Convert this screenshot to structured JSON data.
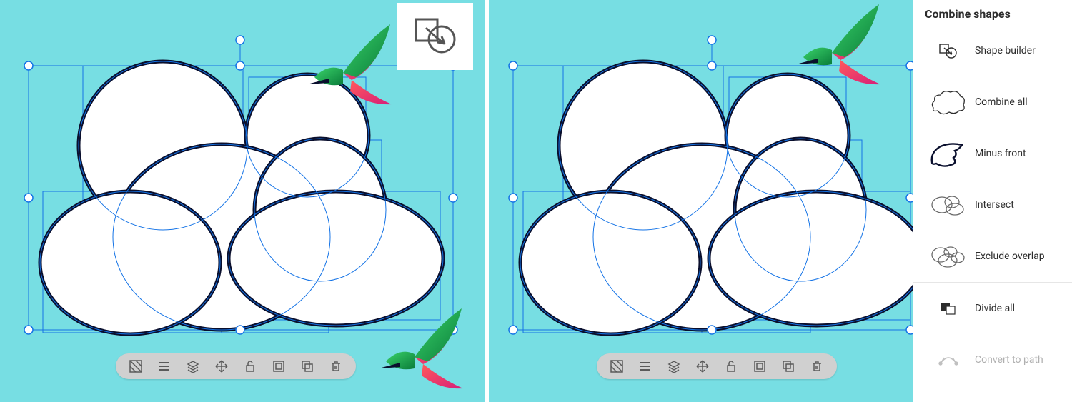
{
  "panel": {
    "title": "Combine shapes",
    "items": [
      {
        "id": "shape-builder",
        "label": "Shape builder",
        "icon": "shapebuilder",
        "interactable": true
      },
      {
        "id": "combine-all",
        "label": "Combine all",
        "icon": "combineall",
        "interactable": true
      },
      {
        "id": "minus-front",
        "label": "Minus front",
        "icon": "minusfront",
        "interactable": true
      },
      {
        "id": "intersect",
        "label": "Intersect",
        "icon": "intersect",
        "interactable": true
      },
      {
        "id": "exclude-overlap",
        "label": "Exclude overlap",
        "icon": "excludeoverlap",
        "interactable": true
      },
      {
        "id": "divide-all",
        "label": "Divide all",
        "icon": "divideall",
        "interactable": true,
        "divider": true
      },
      {
        "id": "convert-to-path",
        "label": "Convert to path",
        "icon": "converttopath",
        "interactable": false,
        "disabled": true
      }
    ]
  },
  "toolbar": {
    "items": [
      {
        "id": "opacity",
        "name": "opacity-icon"
      },
      {
        "id": "stroke",
        "name": "stroke-weight-icon"
      },
      {
        "id": "arrange",
        "name": "arrange-layers-icon"
      },
      {
        "id": "move",
        "name": "move-icon"
      },
      {
        "id": "lock",
        "name": "unlock-icon"
      },
      {
        "id": "group",
        "name": "group-icon"
      },
      {
        "id": "duplicate",
        "name": "duplicate-icon"
      },
      {
        "id": "delete",
        "name": "trash-icon"
      }
    ]
  },
  "badge": {
    "icon": "shapebuilder"
  },
  "colors": {
    "canvas": "#77dee3",
    "selection": "#1473e6",
    "shapeFill": "#ffffff",
    "shapeStroke": "#0a0f2d"
  }
}
